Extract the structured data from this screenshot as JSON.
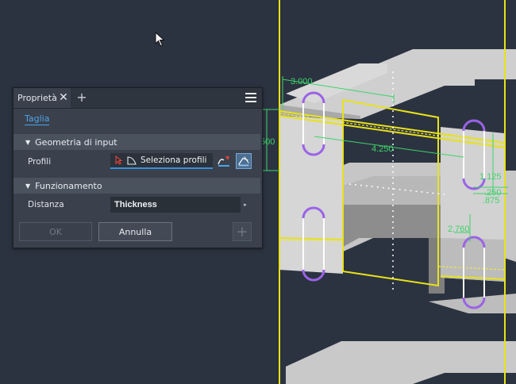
{
  "panel": {
    "tab_title": "Proprietà",
    "tab_close": "✕",
    "tab_add": "+",
    "command_link": "Taglia",
    "section_input": "Geometria di input",
    "profiles_label": "Profili",
    "profiles_button": "Seleziona profili",
    "section_behavior": "Funzionamento",
    "distance_label": "Distanza",
    "distance_value": "Thickness",
    "dropdown_chevron": "▸",
    "caret": "▼",
    "ok_label": "OK",
    "cancel_label": "Annulla",
    "plus_label": "+"
  },
  "viewport": {
    "dimensions": {
      "d1": "3.000",
      "d2": "500",
      "d3": "4.250",
      "d4": "1.125",
      "d5": ".250",
      "d6": ".875",
      "d7": "2.760"
    }
  },
  "colors": {
    "background": "#2c3340",
    "sketch_yellow": "#e8e21a",
    "dimension_green": "#3ed36a",
    "slot_purple": "#9a63e6",
    "panel": "#3a414d",
    "accent_blue": "#3d8fd6"
  }
}
